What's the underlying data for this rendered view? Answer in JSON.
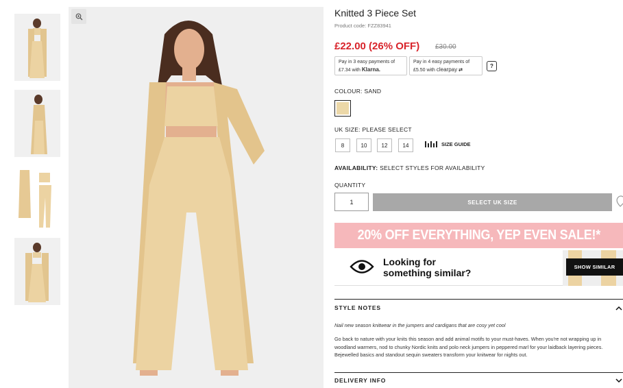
{
  "product": {
    "title": "Knitted 3 Piece Set",
    "code": "Product code: FZZ83941",
    "price": "£22.00 (26% OFF)",
    "rrp": "£30.00",
    "image_alt": "Model wearing sand knitted 3 piece set"
  },
  "payments": {
    "klarna_line1": "Pay in 3 easy payments of",
    "klarna_line2": "£7.34 with",
    "klarna_brand": "Klarna.",
    "clearpay_line1": "Pay in 4 easy payments of",
    "clearpay_line2": "£5.50 with",
    "clearpay_brand": "clearpay",
    "help_label": "?"
  },
  "colour": {
    "label": "COLOUR:",
    "value": "SAND",
    "swatch_color": "#ecd8a8"
  },
  "size": {
    "label": "UK SIZE:",
    "value": "PLEASE SELECT",
    "options": [
      "8",
      "10",
      "12",
      "14"
    ],
    "guide_label": "SIZE GUIDE"
  },
  "availability": {
    "label": "AVAILABILITY:",
    "value": "SELECT STYLES FOR AVAILABILITY"
  },
  "quantity": {
    "label": "QUANTITY",
    "value": "1"
  },
  "add_button": "SELECT UK SIZE",
  "promo": "20% OFF EVERYTHING, YEP EVEN SALE!*",
  "similar": {
    "line1": "Looking for",
    "line2": "something similar?",
    "button": "SHOW SIMILAR"
  },
  "style_notes": {
    "heading": "STYLE NOTES",
    "lead": "Nail new season knitwear in the jumpers and cardigans that are cosy yet cool",
    "body": "Go back to nature with your knits this season and add animal motifs to your must-haves. When you're not wrapping up in woodland warmers, nod to chunky Nordic knits and polo neck jumpers in peppered marl for your laidback layering pieces. Bejewelled basics and standout sequin sweaters transform your knitwear for nights out."
  },
  "delivery": {
    "heading": "DELIVERY INFO"
  },
  "colors": {
    "sale_red": "#d8232a",
    "promo_pink": "#f6b8bb",
    "disabled_grey": "#a8a8a8"
  },
  "icons": [
    "zoom-icon",
    "help-icon",
    "size-guide-icon",
    "wishlist-heart-icon",
    "eye-icon",
    "chevron-up-icon",
    "chevron-down-icon"
  ]
}
